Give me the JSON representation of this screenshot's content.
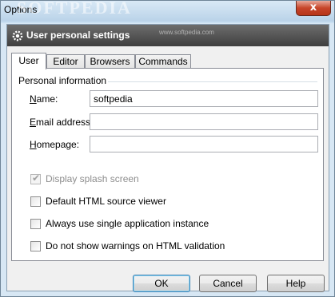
{
  "window": {
    "title": "Options",
    "watermark": "SOFTPEDIA",
    "close_label": "x"
  },
  "header": {
    "title": "User personal settings",
    "watermark": "www.softpedia.com"
  },
  "tabs": [
    {
      "label": "User",
      "active": true
    },
    {
      "label": "Editor",
      "active": false
    },
    {
      "label": "Browsers",
      "active": false
    },
    {
      "label": "Commands",
      "active": false
    }
  ],
  "personal_info": {
    "group_label": "Personal information",
    "name": {
      "label_underlined": "N",
      "label_rest": "ame:",
      "value": "softpedia"
    },
    "email": {
      "label_underlined": "E",
      "label_rest": "mail address:",
      "value": ""
    },
    "homepage": {
      "label_underlined": "H",
      "label_rest": "omepage:",
      "value": ""
    }
  },
  "options": [
    {
      "label": "Display splash screen",
      "checked": true,
      "disabled": true
    },
    {
      "label": "Default HTML source viewer",
      "checked": false,
      "disabled": false
    },
    {
      "label": "Always use single application instance",
      "checked": false,
      "disabled": false
    },
    {
      "label": "Do not show warnings on HTML validation",
      "checked": false,
      "disabled": false
    }
  ],
  "buttons": {
    "ok": "OK",
    "cancel": "Cancel",
    "help": "Help"
  },
  "colors": {
    "header_bg": "#4a4a4a",
    "default_button_border": "#3c7fb1"
  }
}
